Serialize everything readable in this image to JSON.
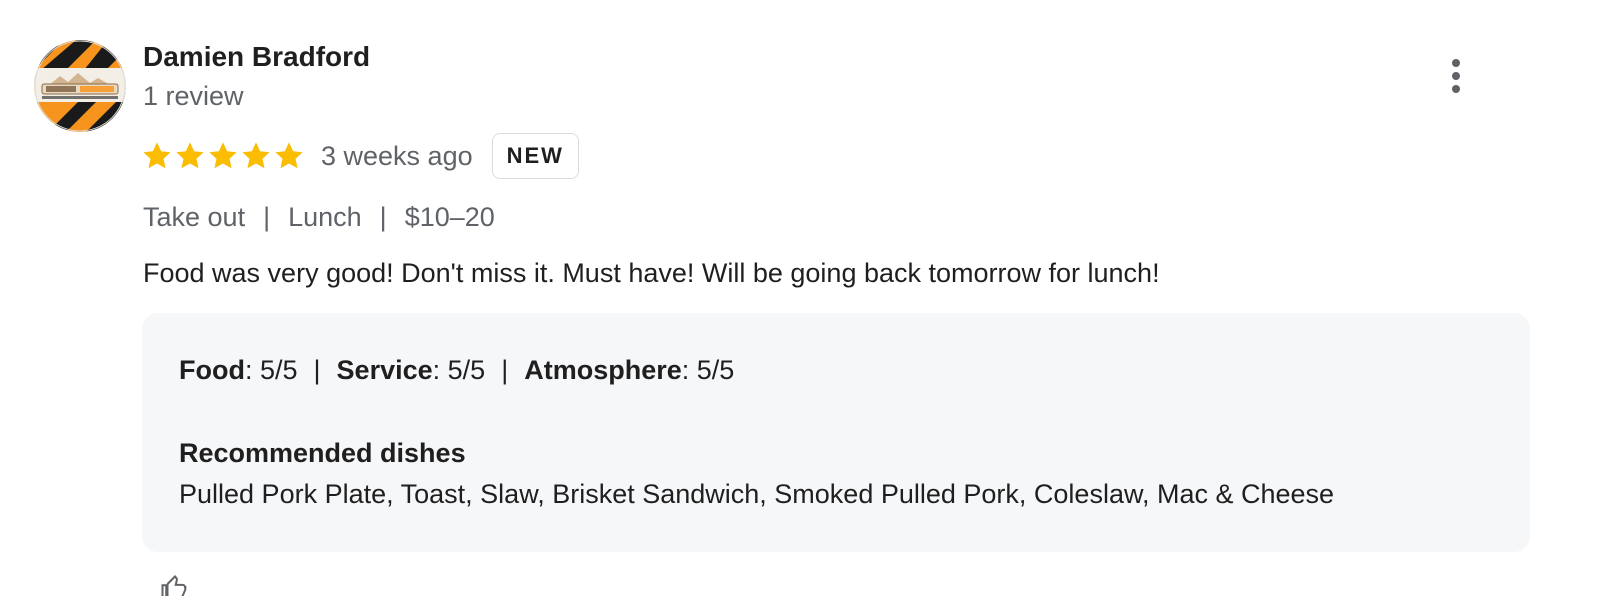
{
  "reviewer": {
    "name": "Damien Bradford",
    "review_count": "1 review",
    "avatar_icon": "logo-avatar-icon"
  },
  "rating": {
    "stars": 5,
    "max_stars": 5,
    "star_color": "#fbbc04",
    "time": "3 weeks ago",
    "badge": "NEW"
  },
  "meta": {
    "service_type": "Take out",
    "meal_type": "Lunch",
    "price_range": "$10–20",
    "separator": "|"
  },
  "review_text": "Food was very good! Don't miss it. Must have! Will be going back tomorrow for lunch!",
  "scores": {
    "food_label": "Food",
    "food_value": ": 5/5",
    "service_label": "Service",
    "service_value": ": 5/5",
    "atmosphere_label": "Atmosphere",
    "atmosphere_value": ": 5/5",
    "separator": "|"
  },
  "recommended": {
    "heading": "Recommended dishes",
    "dishes": "Pulled Pork Plate, Toast, Slaw, Brisket Sandwich, Smoked Pulled Pork, Coleslaw, Mac & Cheese"
  },
  "icons": {
    "more": "more-vert-icon",
    "like": "thumbs-up-icon"
  }
}
